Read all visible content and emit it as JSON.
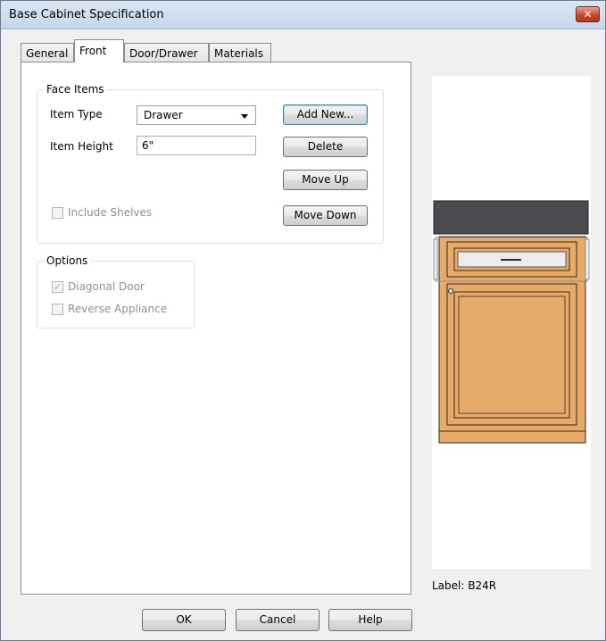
{
  "window": {
    "title": "Base Cabinet Specification",
    "close_glyph": "✕"
  },
  "tabs": [
    {
      "label": "General"
    },
    {
      "label": "Front"
    },
    {
      "label": "Door/Drawer"
    },
    {
      "label": "Materials"
    }
  ],
  "active_tab": "Front",
  "face_items": {
    "legend": "Face Items",
    "item_type_label": "Item Type",
    "item_type_value": "Drawer",
    "item_height_label": "Item Height",
    "item_height_value": "6\"",
    "include_shelves_label": "Include Shelves",
    "include_shelves_checked": false,
    "buttons": {
      "add_new": "Add New...",
      "delete": "Delete",
      "move_up": "Move Up",
      "move_down": "Move Down"
    }
  },
  "options": {
    "legend": "Options",
    "diagonal_door_label": "Diagonal Door",
    "diagonal_door_checked": true,
    "reverse_appliance_label": "Reverse Appliance",
    "reverse_appliance_checked": false
  },
  "preview": {
    "label_text": "Label:  B24R",
    "colors": {
      "countertop": "#4a4b4e",
      "cabinet": "#e6aa6b",
      "outline": "#3a2a1a"
    }
  },
  "footer": {
    "ok": "OK",
    "cancel": "Cancel",
    "help": "Help"
  }
}
